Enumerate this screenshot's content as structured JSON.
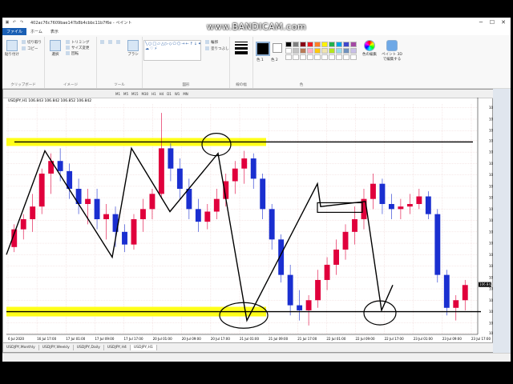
{
  "window": {
    "title": "402ac76c7609bae147b8b4cbbc11b7f6e - ペイント",
    "watermark": "www.BANDICAM.com",
    "controls": {
      "minimize": "─",
      "maximize": "☐",
      "close": "✕"
    }
  },
  "quick_access": [
    "save-icon",
    "undo-icon",
    "redo-icon"
  ],
  "menu_tabs": [
    {
      "label": "ファイル",
      "active": true
    },
    {
      "label": "ホーム",
      "active": false
    },
    {
      "label": "表示",
      "active": false
    }
  ],
  "ribbon": {
    "clipboard": {
      "label": "クリップボード",
      "paste": "貼り付け",
      "cut": "切り取り",
      "copy": "コピー"
    },
    "image": {
      "label": "イメージ",
      "select": "選択",
      "crop": "トリミング",
      "resize": "サイズ変更",
      "rotate": "回転"
    },
    "tools": {
      "label": "ツール",
      "brush": "ブラシ"
    },
    "shapes": {
      "label": "図形",
      "outline": "輪郭",
      "fill": "塗りつぶし"
    },
    "size": {
      "label": "線の幅"
    },
    "colors": {
      "label": "色",
      "color1": "色 1",
      "color2": "色 2",
      "edit": "色の編集",
      "paint3d": "ペイント 3D で編集する",
      "palette": [
        "#000000",
        "#7f7f7f",
        "#880015",
        "#ed1c24",
        "#ff7f27",
        "#fff200",
        "#22b14c",
        "#00a2e8",
        "#3f48cc",
        "#a349a4",
        "#ffffff",
        "#c3c3c3",
        "#b97a57",
        "#ffaec9",
        "#ffc90e",
        "#efe4b0",
        "#b5e61d",
        "#99d9ea",
        "#7092be",
        "#c8bfe7",
        "#ffffff",
        "#ffffff",
        "#ffffff",
        "#ffffff",
        "#ffffff",
        "#ffffff",
        "#ffffff",
        "#ffffff",
        "#ffffff",
        "#ffffff"
      ]
    }
  },
  "mt4": {
    "timeframes": [
      "M1",
      "M5",
      "M15",
      "M30",
      "H1",
      "H4",
      "D1",
      "W1",
      "MN"
    ],
    "symbol_info": "USDJPY,H1  106.843 106.842 106.852 106.842",
    "tabs": [
      {
        "label": "USDJPY,Monthly",
        "active": false
      },
      {
        "label": "USDJPY,Weekly",
        "active": false
      },
      {
        "label": "USDJPY,Daily",
        "active": false
      },
      {
        "label": "USDJPY,H4",
        "active": false
      },
      {
        "label": "USDJPY,H1",
        "active": true
      }
    ],
    "current_price_label": "106.842"
  },
  "chart_data": {
    "type": "candlestick",
    "symbol": "USDJPY",
    "timeframe": "H1",
    "ylim": [
      106.645,
      107.555
    ],
    "y_ticks": [
      107.54,
      107.495,
      107.45,
      107.41,
      107.365,
      107.32,
      107.275,
      107.23,
      107.185,
      107.14,
      107.095,
      107.05,
      107.005,
      106.96,
      106.915,
      106.87,
      106.825,
      106.78,
      106.735,
      106.69,
      106.649
    ],
    "x_ticks": [
      "6 Jul 2020",
      "16 Jul 17:00",
      "17 Jul 01:00",
      "17 Jul 09:00",
      "17 Jul 17:00",
      "20 Jul 01:00",
      "20 Jul 09:00",
      "20 Jul 17:00",
      "21 Jul 01:00",
      "21 Jul 09:00",
      "21 Jul 17:00",
      "22 Jul 01:00",
      "22 Jul 09:00",
      "22 Jul 17:00",
      "23 Jul 01:00",
      "23 Jul 09:00",
      "23 Jul 17:00"
    ],
    "grid": true,
    "candles": [
      [
        106.99,
        107.08,
        106.97,
        107.06
      ],
      [
        107.06,
        107.12,
        107.02,
        107.1
      ],
      [
        107.1,
        107.2,
        107.05,
        107.15
      ],
      [
        107.15,
        107.3,
        107.12,
        107.28
      ],
      [
        107.28,
        107.36,
        107.2,
        107.33
      ],
      [
        107.33,
        107.38,
        107.25,
        107.29
      ],
      [
        107.29,
        107.32,
        107.18,
        107.22
      ],
      [
        107.22,
        107.26,
        107.12,
        107.16
      ],
      [
        107.16,
        107.22,
        107.08,
        107.18
      ],
      [
        107.18,
        107.22,
        107.06,
        107.1
      ],
      [
        107.1,
        107.16,
        107.02,
        107.12
      ],
      [
        107.12,
        107.15,
        106.99,
        107.05
      ],
      [
        107.05,
        107.08,
        106.97,
        107.0
      ],
      [
        107.0,
        107.12,
        106.98,
        107.1
      ],
      [
        107.1,
        107.18,
        107.05,
        107.14
      ],
      [
        107.14,
        107.22,
        107.1,
        107.2
      ],
      [
        107.2,
        107.52,
        107.18,
        107.38
      ],
      [
        107.38,
        107.4,
        107.25,
        107.3
      ],
      [
        107.3,
        107.34,
        107.18,
        107.22
      ],
      [
        107.22,
        107.26,
        107.1,
        107.14
      ],
      [
        107.14,
        107.18,
        107.05,
        107.09
      ],
      [
        107.09,
        107.16,
        107.06,
        107.13
      ],
      [
        107.13,
        107.22,
        107.1,
        107.18
      ],
      [
        107.18,
        107.28,
        107.15,
        107.25
      ],
      [
        107.25,
        107.33,
        107.2,
        107.3
      ],
      [
        107.3,
        107.37,
        107.24,
        107.34
      ],
      [
        107.34,
        107.36,
        107.22,
        107.26
      ],
      [
        107.26,
        107.28,
        107.1,
        107.14
      ],
      [
        107.14,
        107.16,
        106.98,
        107.02
      ],
      [
        107.02,
        107.04,
        106.85,
        106.88
      ],
      [
        106.88,
        106.92,
        106.72,
        106.76
      ],
      [
        106.76,
        106.82,
        106.7,
        106.74
      ],
      [
        106.74,
        106.8,
        106.68,
        106.78
      ],
      [
        106.78,
        106.9,
        106.75,
        106.86
      ],
      [
        106.86,
        106.95,
        106.82,
        106.92
      ],
      [
        106.92,
        107.02,
        106.88,
        106.98
      ],
      [
        106.98,
        107.08,
        106.94,
        107.05
      ],
      [
        107.05,
        107.15,
        107.0,
        107.1
      ],
      [
        107.1,
        107.22,
        107.06,
        107.18
      ],
      [
        107.18,
        107.28,
        107.14,
        107.24
      ],
      [
        107.24,
        107.26,
        107.12,
        107.16
      ],
      [
        107.16,
        107.2,
        107.1,
        107.14
      ],
      [
        107.14,
        107.18,
        107.1,
        107.15
      ],
      [
        107.15,
        107.2,
        107.12,
        107.16
      ],
      [
        107.16,
        107.22,
        107.14,
        107.19
      ],
      [
        107.19,
        107.21,
        107.1,
        107.12
      ],
      [
        107.12,
        107.14,
        106.85,
        106.88
      ],
      [
        106.88,
        106.9,
        106.72,
        106.75
      ],
      [
        106.75,
        106.8,
        106.7,
        106.78
      ],
      [
        106.78,
        106.86,
        106.74,
        106.84
      ]
    ],
    "support_line": 106.735,
    "resistance_line": 107.405,
    "zigzag": [
      106.96,
      107.37,
      106.95,
      107.38,
      107.13,
      107.36,
      106.7,
      107.24,
      107.15,
      107.17,
      106.74,
      106.84
    ]
  }
}
